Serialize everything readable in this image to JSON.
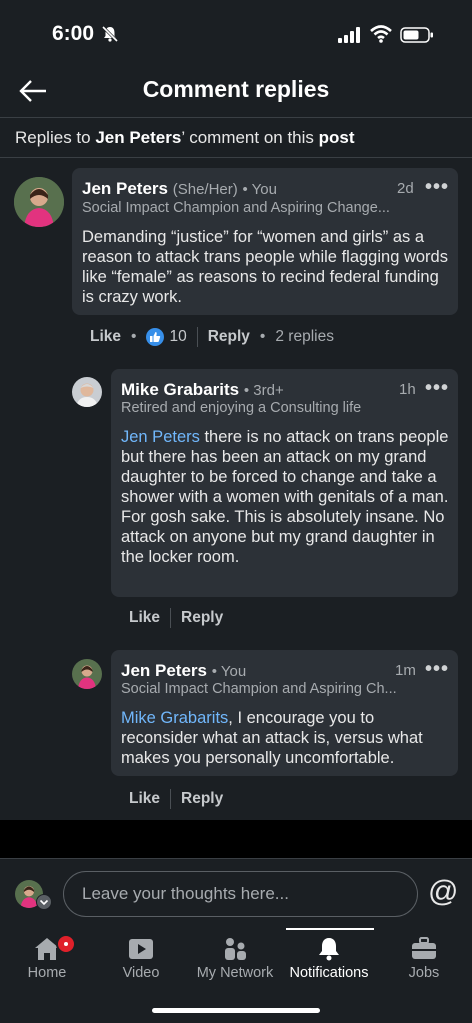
{
  "status_bar": {
    "time": "6:00"
  },
  "header": {
    "title": "Comment replies"
  },
  "context": {
    "prefix": "Replies to ",
    "author": "Jen Peters",
    "middle": "’ comment on this ",
    "post_word": "post"
  },
  "comments": [
    {
      "name": "Jen Peters",
      "pronouns": "(She/Her)",
      "relation": "• You",
      "headline": "Social Impact Champion and Aspiring Change...",
      "time": "2d",
      "text": "Demanding “justice” for “women and girls” as a reason to attack trans people while flagging words like “female” as reasons to recind federal funding is crazy work.",
      "like_label": "Like",
      "like_count": "10",
      "reply_label": "Reply",
      "replies_label": "2 replies"
    },
    {
      "name": "Mike Grabarits",
      "relation": "• 3rd+",
      "headline": "Retired and enjoying a Consulting life",
      "time": "1h",
      "mention": "Jen Peters",
      "text": " there is no attack on trans people but there has been an attack on my grand daughter to be forced to change and take a shower with a women with genitals of a man. For gosh sake. This is absolutely insane. No attack on anyone but my grand daughter in the locker room.",
      "like_label": "Like",
      "reply_label": "Reply"
    },
    {
      "name": "Jen Peters",
      "relation": "• You",
      "headline": "Social Impact Champion and Aspiring Ch...",
      "time": "1m",
      "mention": "Mike Grabarits",
      "text": ", I encourage you to reconsider what an attack is, versus what makes you personally uncomfortable.",
      "like_label": "Like",
      "reply_label": "Reply"
    }
  ],
  "compose": {
    "placeholder": "Leave your thoughts here..."
  },
  "nav": [
    {
      "label": "Home",
      "icon": "home-icon"
    },
    {
      "label": "Video",
      "icon": "video-icon"
    },
    {
      "label": "My Network",
      "icon": "network-icon"
    },
    {
      "label": "Notifications",
      "icon": "bell-icon",
      "active": true
    },
    {
      "label": "Jobs",
      "icon": "briefcase-icon"
    }
  ],
  "colors": {
    "background": "#1b1f23",
    "bubble": "#2c3137",
    "link": "#71b7fb",
    "like": "#378fe9",
    "badge": "#e0202a"
  }
}
